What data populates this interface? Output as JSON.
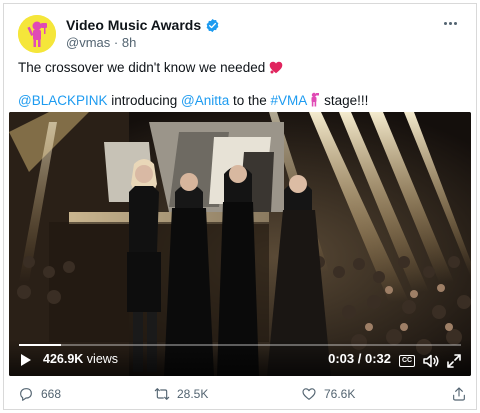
{
  "account": {
    "display_name": "Video Music Awards",
    "handle": "@vmas",
    "separator": "·",
    "age": "8h"
  },
  "tweet": {
    "line1": "The crossover we didn't know we needed",
    "mention1": "@BLACKPINK",
    "word_introducing": " introducing ",
    "mention2": "@Anitta",
    "word_to_the": " to the ",
    "hashtag": "#VMA",
    "stage_text": " stage!!!"
  },
  "video": {
    "views_count": "426.9K",
    "views_unit": " views",
    "time_display": "0:03 / 0:32",
    "cc_label": "CC",
    "progress_fraction": 0.094
  },
  "actions": {
    "replies": "668",
    "retweets": "28.5K",
    "likes": "76.6K"
  },
  "colors": {
    "link": "#1d9bf0",
    "verified": "#1d9bf0",
    "avatar_bg": "#f5e63a",
    "avatar_figure": "#e04bb5",
    "heart": "#e0245e"
  }
}
